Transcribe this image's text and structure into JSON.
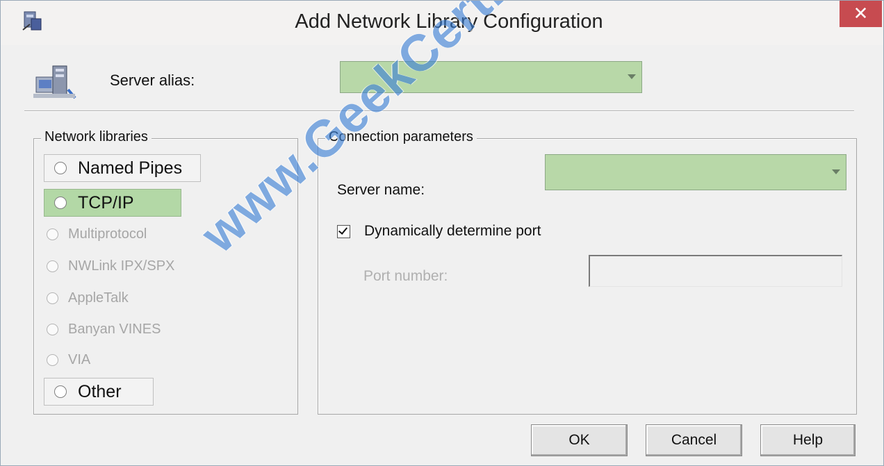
{
  "window": {
    "title": "Add Network Library Configuration",
    "close_label": "✕"
  },
  "alias": {
    "label": "Server alias:",
    "value": ""
  },
  "network_libraries": {
    "legend": "Network libraries",
    "options": [
      {
        "label": "Named Pipes",
        "enabled": true,
        "selected": false
      },
      {
        "label": "TCP/IP",
        "enabled": true,
        "selected": true
      },
      {
        "label": "Multiprotocol",
        "enabled": false,
        "selected": false
      },
      {
        "label": "NWLink IPX/SPX",
        "enabled": false,
        "selected": false
      },
      {
        "label": "AppleTalk",
        "enabled": false,
        "selected": false
      },
      {
        "label": "Banyan VINES",
        "enabled": false,
        "selected": false
      },
      {
        "label": "VIA",
        "enabled": false,
        "selected": false
      },
      {
        "label": "Other",
        "enabled": true,
        "selected": false
      }
    ]
  },
  "connection": {
    "legend": "Connection parameters",
    "server_name_label": "Server name:",
    "server_name_value": "",
    "dynamic_port_label": "Dynamically determine port",
    "dynamic_port_checked": true,
    "port_label": "Port number:",
    "port_value": ""
  },
  "buttons": {
    "ok": "OK",
    "cancel": "Cancel",
    "help": "Help"
  },
  "watermark": "www.GeekCert.com",
  "colors": {
    "highlight": "#b8d8a8",
    "close": "#c74b50",
    "watermark": "#3a7fd6"
  }
}
